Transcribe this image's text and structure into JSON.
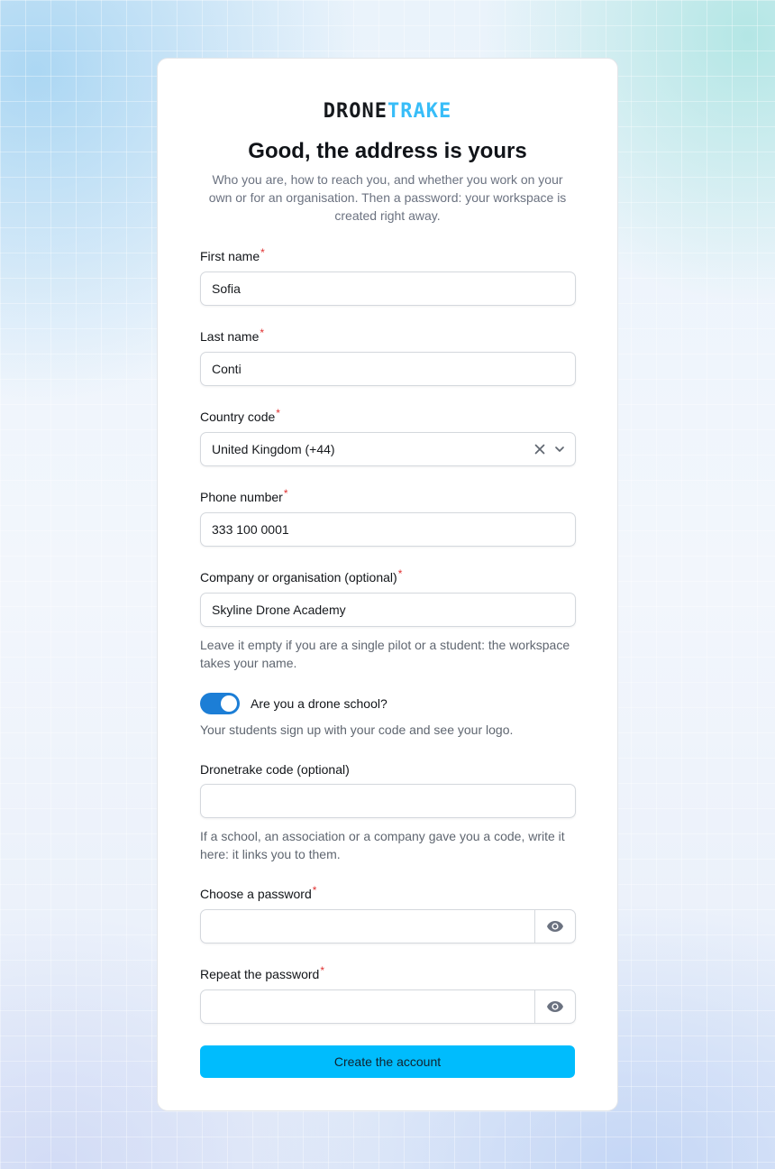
{
  "brand": {
    "part1": "DRONE",
    "part2": "TRAKE"
  },
  "header": {
    "title": "Good, the address is yours",
    "subtitle": "Who you are, how to reach you, and whether you work on your own or for an organisation. Then a password: your workspace is created right away."
  },
  "form": {
    "required_mark": "*",
    "first_name": {
      "label": "First name",
      "value": "Sofia"
    },
    "last_name": {
      "label": "Last name",
      "value": "Conti"
    },
    "country_code": {
      "label": "Country code",
      "value": "United Kingdom (+44)"
    },
    "phone": {
      "label": "Phone number",
      "value": "333 100 0001"
    },
    "company": {
      "label": "Company or organisation (optional)",
      "value": "Skyline Drone Academy",
      "help": "Leave it empty if you are a single pilot or a student: the workspace takes your name."
    },
    "drone_school": {
      "label": "Are you a drone school?",
      "enabled": true,
      "help": "Your students sign up with your code and see your logo."
    },
    "code": {
      "label": "Dronetrake code (optional)",
      "value": "",
      "help": "If a school, an association or a company gave you a code, write it here: it links you to them."
    },
    "password": {
      "label": "Choose a password",
      "value": ""
    },
    "password_repeat": {
      "label": "Repeat the password",
      "value": ""
    },
    "submit_label": "Create the account"
  },
  "colors": {
    "accent": "#00bcfd",
    "toggle": "#1c7ed6",
    "logo_accent": "#38bdf8",
    "required": "#e03131"
  },
  "icons": {
    "clear": "close-icon",
    "dropdown": "chevron-down-icon",
    "show_password": "eye-icon"
  }
}
